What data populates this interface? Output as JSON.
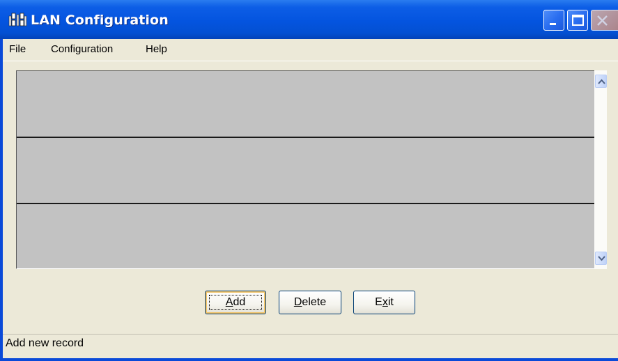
{
  "window": {
    "title": "LAN Configuration",
    "title_icon": "network-ports-icon",
    "controls": [
      "minimize-icon",
      "maximize-icon",
      "close-icon"
    ]
  },
  "menu": {
    "file": "File",
    "configuration": "Configuration",
    "help": "Help"
  },
  "grid": {
    "rows": [
      {
        "label": ""
      },
      {
        "label": ""
      },
      {
        "label": ""
      }
    ]
  },
  "buttons": {
    "add": {
      "label": "Add",
      "mnemonic": "A"
    },
    "delete": {
      "label": "Delete",
      "mnemonic": "D"
    },
    "exit": {
      "label": "Exit",
      "mnemonic": "x"
    }
  },
  "statusbar": {
    "text": "Add new record"
  },
  "colors": {
    "titlebar": "#0454df",
    "face": "#ece9d8",
    "grid_row": "#c2c2c2",
    "focus_ring": "#f2c56b"
  }
}
